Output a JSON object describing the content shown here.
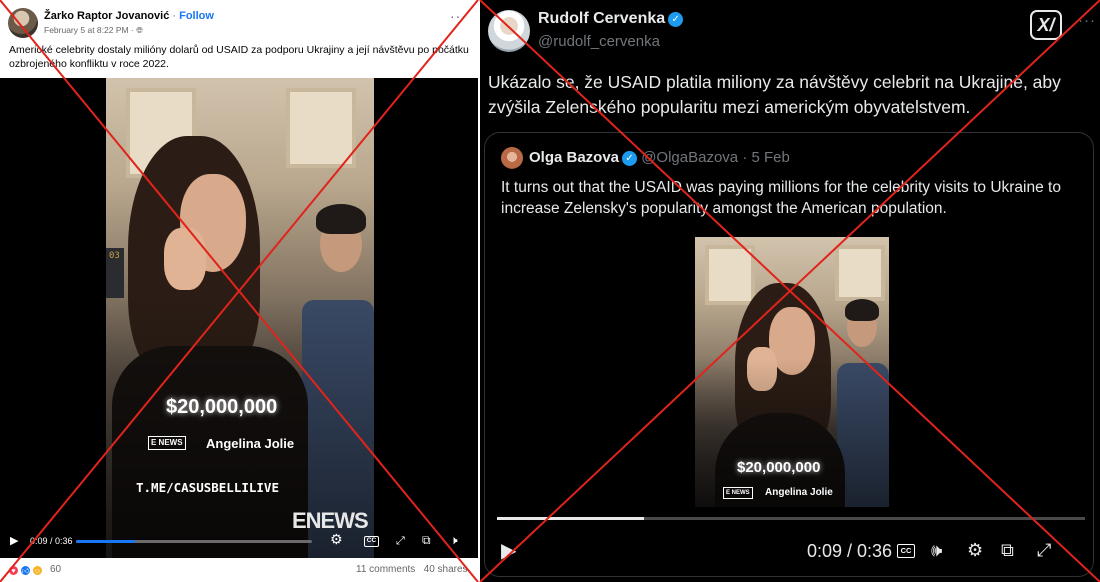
{
  "facebook_post": {
    "author": "Žarko Raptor Jovanović",
    "separator": " · ",
    "follow_label": "Follow",
    "timestamp": "February 5 at 8:22 PM · ",
    "visibility_icon": "globe-icon",
    "more_icon": "ellipsis-icon",
    "text": "Americké celebrity dostaly milióny dolarů od USAID za podporu Ukrajiny a její návštěvu po počátku ozbrojeného konfliktu v roce 2022.",
    "video": {
      "price": "$20,000,000",
      "enews_badge": "E NEWS",
      "person": "Angelina Jolie",
      "channel": "T.ME/CASUSBELLILIVE",
      "logo": "ENEWS",
      "scene_board": "03",
      "time": "0:09 / 0:36",
      "progress": 0.25,
      "cc_label": "CC"
    },
    "reaction_count": "60",
    "comments": "11 comments",
    "shares": "40 shares"
  },
  "x_post": {
    "author": "Rudolf Cervenka",
    "handle": "@rudolf_cervenka",
    "grok_label": "X/",
    "text": "Ukázalo se, že USAID platila miliony za návštěvy celebrit na Ukrajině, aby zvýšila Zelenského popularitu mezi americkým obyvatelstvem.",
    "quote": {
      "author": "Olga Bazova",
      "handle_date": "@OlgaBazova · 5 Feb",
      "text": "It turns out that the USAID was paying millions for the celebrity visits to Ukraine to increase Zelensky's popularity amongst the American population.",
      "video": {
        "price": "$20,000,000",
        "enews_badge": "E NEWS",
        "person": "Angelina Jolie",
        "time": "0:09 / 0:36",
        "progress": 0.25,
        "cc_label": "CC"
      }
    }
  },
  "colors": {
    "facebook_blue": "#1877f2",
    "x_blue": "#1d9bf0",
    "cross_red": "#e0241b"
  }
}
